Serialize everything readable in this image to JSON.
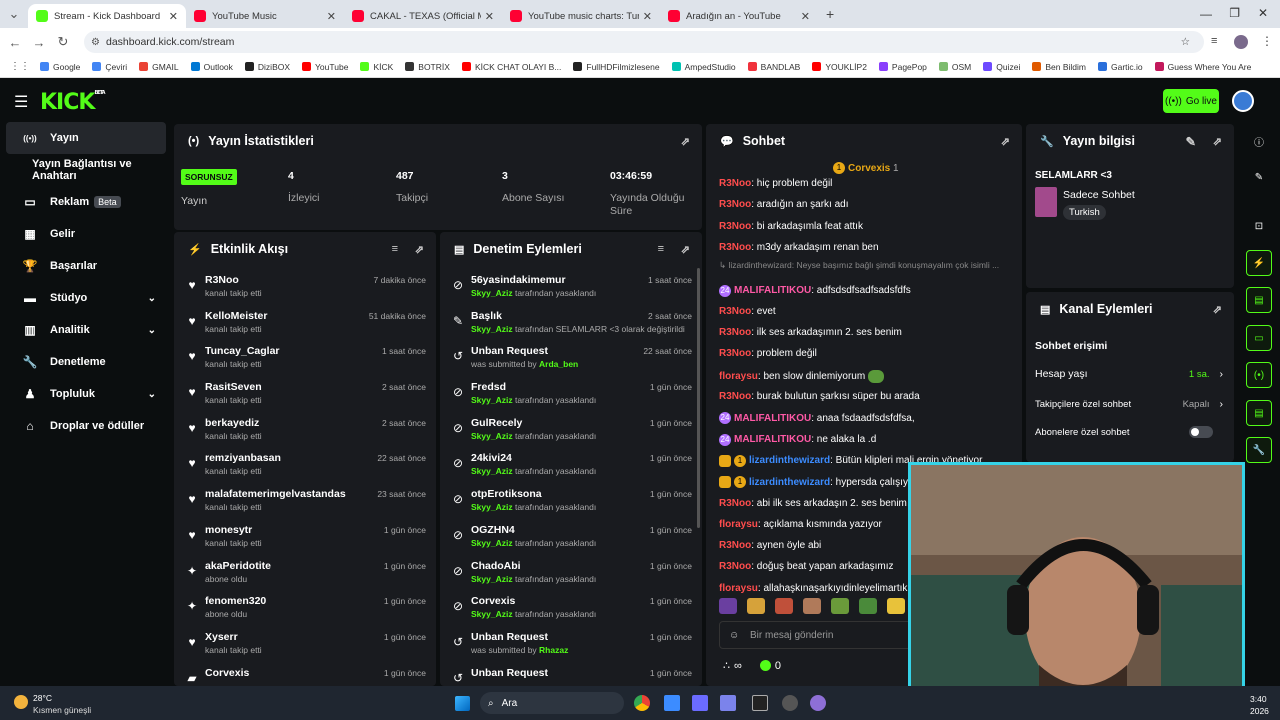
{
  "browser": {
    "tabs": [
      {
        "title": "Stream - Kick Dashboard",
        "color": "#53fc18",
        "active": true
      },
      {
        "title": "YouTube Music",
        "color": "#ff0033",
        "active": false
      },
      {
        "title": "CAKAL - TEXAS (Official Music V",
        "color": "#ff0033",
        "active": false
      },
      {
        "title": "YouTube music charts: Turkey T",
        "color": "#ff0033",
        "active": false
      },
      {
        "title": "Aradığın an - YouTube",
        "color": "#ff0033",
        "active": false
      }
    ],
    "url": "dashboard.kick.com/stream",
    "bookmarks": [
      {
        "label": "Google",
        "color": "#4285f4"
      },
      {
        "label": "Çeviri",
        "color": "#4285f4"
      },
      {
        "label": "GMAIL",
        "color": "#ea4335"
      },
      {
        "label": "Outlook",
        "color": "#0078d4"
      },
      {
        "label": "DiziBOX",
        "color": "#222222"
      },
      {
        "label": "YouTube",
        "color": "#ff0000"
      },
      {
        "label": "KİCK",
        "color": "#53fc18"
      },
      {
        "label": "BOTRİX",
        "color": "#333333"
      },
      {
        "label": "KİCK CHAT OLAYI B...",
        "color": "#ff0000"
      },
      {
        "label": "FullHDFilmizlesene",
        "color": "#222222"
      },
      {
        "label": "AmpedStudio",
        "color": "#00c2b2"
      },
      {
        "label": "BANDLAB",
        "color": "#f0323c"
      },
      {
        "label": "YOUKLİP2",
        "color": "#ff0000"
      },
      {
        "label": "PagePop",
        "color": "#8a3ffc"
      },
      {
        "label": "OSM",
        "color": "#7ebc6f"
      },
      {
        "label": "Quizei",
        "color": "#6d4aff"
      },
      {
        "label": "Ben Bildim",
        "color": "#e05a00"
      },
      {
        "label": "Gartic.io",
        "color": "#2a6fdb"
      },
      {
        "label": "Guess Where You Are",
        "color": "#c2185b"
      }
    ]
  },
  "header": {
    "logo": "KICK",
    "logo_sup": "BETA",
    "golive_label": "Go live"
  },
  "sidebar": {
    "items": [
      {
        "label": "Yayın",
        "icon": "broadcast-icon",
        "glyph": "((•))",
        "active": true
      },
      {
        "label": "Yayın Bağlantısı ve Anahtarı",
        "icon": "",
        "glyph": "",
        "active": false
      },
      {
        "label": "Reklam",
        "icon": "ad-icon",
        "glyph": "▭",
        "badge": "Beta"
      },
      {
        "label": "Gelir",
        "icon": "revenue-icon",
        "glyph": "▦"
      },
      {
        "label": "Başarılar",
        "icon": "trophy-icon",
        "glyph": "🏆"
      },
      {
        "label": "Stüdyo",
        "icon": "studio-icon",
        "glyph": "▬",
        "chevron": true
      },
      {
        "label": "Analitik",
        "icon": "chart-icon",
        "glyph": "▥",
        "chevron": true
      },
      {
        "label": "Denetleme",
        "icon": "wrench-icon",
        "glyph": "🔧"
      },
      {
        "label": "Topluluk",
        "icon": "community-icon",
        "glyph": "♟",
        "chevron": true
      },
      {
        "label": "Droplar ve ödüller",
        "icon": "drops-icon",
        "glyph": "⌂"
      }
    ]
  },
  "stats": {
    "title": "Yayın İstatistikleri",
    "status_badge": "SORUNSUZ",
    "status_label": "Yayın",
    "viewers": "4",
    "viewers_label": "İzleyici",
    "followers": "487",
    "followers_label": "Takipçi",
    "subs": "3",
    "subs_label": "Abone Sayısı",
    "uptime": "03:46:59",
    "uptime_label": "Yayında Olduğu Süre"
  },
  "activity": {
    "title": "Etkinlik Akışı",
    "rows": [
      {
        "name": "R3Noo",
        "sub": "kanalı takip etti",
        "time": "7 dakika önce",
        "icon": "heart-icon",
        "glyph": "♥"
      },
      {
        "name": "KelloMeister",
        "sub": "kanalı takip etti",
        "time": "51 dakika önce",
        "icon": "heart-icon",
        "glyph": "♥"
      },
      {
        "name": "Tuncay_Caglar",
        "sub": "kanalı takip etti",
        "time": "1 saat önce",
        "icon": "heart-icon",
        "glyph": "♥"
      },
      {
        "name": "RasitSeven",
        "sub": "kanalı takip etti",
        "time": "2 saat önce",
        "icon": "heart-icon",
        "glyph": "♥"
      },
      {
        "name": "berkayediz",
        "sub": "kanalı takip etti",
        "time": "2 saat önce",
        "icon": "heart-icon",
        "glyph": "♥"
      },
      {
        "name": "remziyanbasan",
        "sub": "kanalı takip etti",
        "time": "22 saat önce",
        "icon": "heart-icon",
        "glyph": "♥"
      },
      {
        "name": "malafatemerimgelvastandas",
        "sub": "kanalı takip etti",
        "time": "23 saat önce",
        "icon": "heart-icon",
        "glyph": "♥"
      },
      {
        "name": "monesytr",
        "sub": "kanalı takip etti",
        "time": "1 gün önce",
        "icon": "heart-icon",
        "glyph": "♥"
      },
      {
        "name": "akaPeridotite",
        "sub": "abone oldu",
        "time": "1 gün önce",
        "icon": "sparkle-icon",
        "glyph": "✦"
      },
      {
        "name": "fenomen320",
        "sub": "abone oldu",
        "time": "1 gün önce",
        "icon": "sparkle-icon",
        "glyph": "✦"
      },
      {
        "name": "Xyserr",
        "sub": "kanalı takip etti",
        "time": "1 gün önce",
        "icon": "heart-icon",
        "glyph": "♥"
      },
      {
        "name": "Corvexis",
        "sub": "",
        "time": "1 gün önce",
        "icon": "gift-icon",
        "glyph": "▰"
      }
    ]
  },
  "moderation": {
    "title": "Denetim Eylemleri",
    "rows": [
      {
        "name": "56yasindakimemur",
        "actor": "Skyy_Aziz",
        "rest": " tarafından yasaklandı",
        "time": "1 saat önce",
        "icon": "ban-icon",
        "glyph": "⊘"
      },
      {
        "name": "Başlık",
        "actor": "Skyy_Aziz",
        "rest": " tarafından SELAMLARR <3 olarak değiştirildi",
        "time": "2 saat önce",
        "icon": "edit-title-icon",
        "glyph": "✎"
      },
      {
        "name": "Unban Request",
        "actor": "Arda_ben",
        "pre": "was submitted by ",
        "rest": "",
        "time": "22 saat önce",
        "icon": "undo-icon",
        "glyph": "↺"
      },
      {
        "name": "Fredsd",
        "actor": "Skyy_Aziz",
        "rest": " tarafından yasaklandı",
        "time": "1 gün önce",
        "icon": "ban-icon",
        "glyph": "⊘"
      },
      {
        "name": "GulRecely",
        "actor": "Skyy_Aziz",
        "rest": " tarafından yasaklandı",
        "time": "1 gün önce",
        "icon": "ban-icon",
        "glyph": "⊘"
      },
      {
        "name": "24kivi24",
        "actor": "Skyy_Aziz",
        "rest": " tarafından yasaklandı",
        "time": "1 gün önce",
        "icon": "ban-icon",
        "glyph": "⊘"
      },
      {
        "name": "otpErotiksona",
        "actor": "Skyy_Aziz",
        "rest": " tarafından yasaklandı",
        "time": "1 gün önce",
        "icon": "ban-icon",
        "glyph": "⊘"
      },
      {
        "name": "OGZHN4",
        "actor": "Skyy_Aziz",
        "rest": " tarafından yasaklandı",
        "time": "1 gün önce",
        "icon": "ban-icon",
        "glyph": "⊘"
      },
      {
        "name": "ChadoAbi",
        "actor": "Skyy_Aziz",
        "rest": " tarafından yasaklandı",
        "time": "1 gün önce",
        "icon": "ban-icon",
        "glyph": "⊘"
      },
      {
        "name": "Corvexis",
        "actor": "Skyy_Aziz",
        "rest": " tarafından yasaklandı",
        "time": "1 gün önce",
        "icon": "ban-icon",
        "glyph": "⊘"
      },
      {
        "name": "Unban Request",
        "actor": "Rhazaz",
        "pre": "was submitted by ",
        "rest": "",
        "time": "1 gün önce",
        "icon": "undo-icon",
        "glyph": "↺"
      },
      {
        "name": "Unban Request",
        "actor": "",
        "pre": "",
        "rest": "",
        "time": "1 gün önce",
        "icon": "undo-icon",
        "glyph": "↺"
      }
    ]
  },
  "chat": {
    "title": "Sohbet",
    "pinned_user": "Corvexis",
    "pinned_count": "1",
    "messages": [
      {
        "user": "R3Noo",
        "cls": "u1",
        "text": ": hiç problem değil"
      },
      {
        "user": "R3Noo",
        "cls": "u1",
        "text": ": aradığın an şarkı adı"
      },
      {
        "user": "R3Noo",
        "cls": "u1",
        "text": ": bi arkadaşımla feat attık"
      },
      {
        "user": "R3Noo",
        "cls": "u1",
        "text": ": m3dy arkadaşım renan ben"
      },
      {
        "user": "",
        "cls": "sysmsg",
        "text": "↳ lizardinthewizard: Neyse başımız bağlı şimdi konuşmayalım çok isimli ..."
      },
      {
        "user": "MALIFALITIKOU",
        "cls": "u3",
        "text": ": adfsdsdfsadfsadsfdfs",
        "badge": "sub"
      },
      {
        "user": "R3Noo",
        "cls": "u1",
        "text": ": evet"
      },
      {
        "user": "R3Noo",
        "cls": "u1",
        "text": ": ilk ses arkadaşımın 2. ses benim"
      },
      {
        "user": "R3Noo",
        "cls": "u1",
        "text": ": problem değil"
      },
      {
        "user": "floraysu",
        "cls": "u1",
        "text": ": ben slow dinlemiyorum"
      },
      {
        "user": "R3Noo",
        "cls": "u1",
        "text": ": burak bulutun şarkısı süper bu arada"
      },
      {
        "user": "MALIFALITIKOU",
        "cls": "u3",
        "text": ": anaa fsdaadfsdsfdfsa,",
        "badge": "sub"
      },
      {
        "user": "MALIFALITIKOU",
        "cls": "u3",
        "text": ": ne alaka la .d",
        "badge": "sub"
      },
      {
        "user": "lizardinthewizard",
        "cls": "u4",
        "text": ": Bütün klipleri mali ergin yönetiyor",
        "badge": "crown"
      },
      {
        "user": "lizardinthewizard",
        "cls": "u4",
        "text": ": hypersda çalışıy",
        "badge": "crown"
      },
      {
        "user": "R3Noo",
        "cls": "u1",
        "text": ": abi ilk ses arkadaşın 2. ses benim"
      },
      {
        "user": "floraysu",
        "cls": "u1",
        "text": ": açıklama kısmında yazıyor"
      },
      {
        "user": "R3Noo",
        "cls": "u1",
        "text": ": aynen öyle abi"
      },
      {
        "user": "R3Noo",
        "cls": "u1",
        "text": ": doğuş beat yapan arkadaşımız"
      },
      {
        "user": "floraysu",
        "cls": "u1",
        "text": ": allahaşkınaşarkıyıdinleyelimartık"
      }
    ],
    "input_placeholder": "Bir mesaj gönderin",
    "infinity": "∞",
    "kick_count": "0"
  },
  "stream_info": {
    "title": "Yayın bilgisi",
    "stream_title": "SELAMLARR <3",
    "category": "Sadece Sohbet",
    "language": "Turkish"
  },
  "channel_actions": {
    "title": "Kanal Eylemleri",
    "section": "Sohbet erişimi",
    "account_age_label": "Hesap yaşı",
    "account_age_value": "1 sa.",
    "followers_only_label": "Takipçilere özel sohbet",
    "followers_only_value": "Kapalı",
    "subs_only_label": "Abonelere özel sohbet"
  },
  "taskbar": {
    "temp": "28°C",
    "weather": "Kısmen güneşli",
    "search": "Ara",
    "time": "3:40",
    "date": "2026"
  },
  "colors": {
    "accent": "#53fc18",
    "panel": "#191b1f",
    "bg": "#0b0e0f",
    "webcam_border": "#35d3e8"
  }
}
